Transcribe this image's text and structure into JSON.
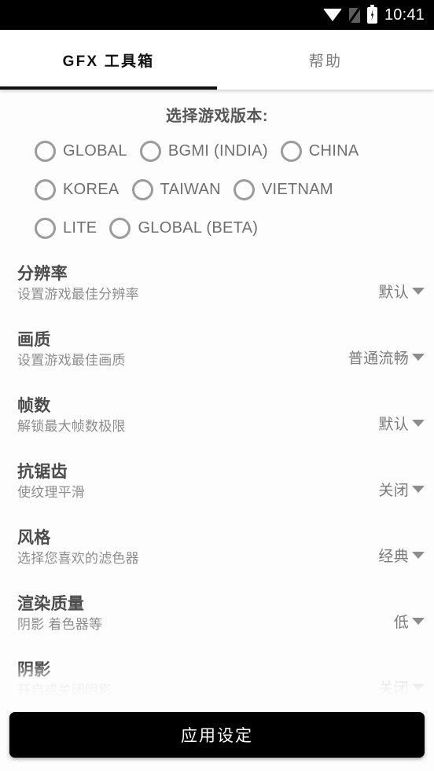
{
  "statusbar": {
    "time": "10:41",
    "icons": [
      "wifi-icon",
      "no-sim-icon",
      "battery-charging-icon"
    ]
  },
  "tabs": [
    {
      "label": "GFX 工具箱",
      "active": true
    },
    {
      "label": "帮助",
      "active": false
    }
  ],
  "version_section": {
    "title": "选择游戏版本:",
    "options": [
      {
        "label": "GLOBAL",
        "checked": false
      },
      {
        "label": "BGMI (INDIA)",
        "checked": false
      },
      {
        "label": "CHINA",
        "checked": false
      },
      {
        "label": "KOREA",
        "checked": false
      },
      {
        "label": "TAIWAN",
        "checked": false
      },
      {
        "label": "VIETNAM",
        "checked": false
      },
      {
        "label": "LITE",
        "checked": false
      },
      {
        "label": "GLOBAL (BETA)",
        "checked": false
      }
    ]
  },
  "settings": [
    {
      "title": "分辨率",
      "subtitle": "设置游戏最佳分辨率",
      "value": "默认"
    },
    {
      "title": "画质",
      "subtitle": "设置游戏最佳画质",
      "value": "普通流畅"
    },
    {
      "title": "帧数",
      "subtitle": "解锁最大帧数极限",
      "value": "默认"
    },
    {
      "title": "抗锯齿",
      "subtitle": "使纹理平滑",
      "value": "关闭"
    },
    {
      "title": "风格",
      "subtitle": "选择您喜欢的滤色器",
      "value": "经典"
    },
    {
      "title": "渲染质量",
      "subtitle": "阴影 着色器等",
      "value": "低"
    },
    {
      "title": "阴影",
      "subtitle": "开启或关闭阴影",
      "value": "关闭"
    }
  ],
  "apply_button": {
    "label": "应用设定"
  },
  "colors": {
    "accent": "#000000",
    "title_text": "#4c4c4c",
    "subtitle_text": "#8d8d8d",
    "value_text": "#7b7b7b",
    "radio_border": "#9b9b9b",
    "background": "#fdfdfd"
  }
}
